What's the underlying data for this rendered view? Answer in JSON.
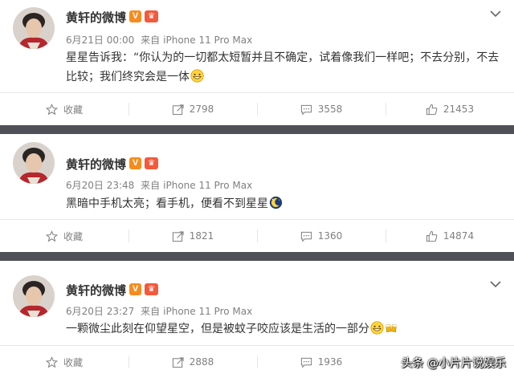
{
  "posts": [
    {
      "name": "黄轩的微博",
      "badge_v": "V",
      "time": "6月21日 00:00",
      "source_prefix": "来自",
      "source": "iPhone 11 Pro Max",
      "content": "星星告诉我：“你认为的一切都太短暂并且不确定，试着像我们一样吧；不去分别，不去比较；我们终究会是一体",
      "emoji": "grin-emoji",
      "actions": {
        "favorite": "收藏",
        "repost": "2798",
        "comment": "3558",
        "like": "21453"
      }
    },
    {
      "name": "黄轩的微博",
      "badge_v": "V",
      "time": "6月20日 23:48",
      "source_prefix": "来自",
      "source": "iPhone 11 Pro Max",
      "content": "黑暗中手机太亮；看手机，便看不到星星",
      "emoji": "moon-emoji",
      "actions": {
        "favorite": "收藏",
        "repost": "1821",
        "comment": "1360",
        "like": "14874"
      }
    },
    {
      "name": "黄轩的微博",
      "badge_v": "V",
      "time": "6月20日 23:27",
      "source_prefix": "来自",
      "source": "iPhone 11 Pro Max",
      "content": "一颗微尘此刻在仰望星空，但是被蚊子咬应该是生活的一部分",
      "emoji": "grin-emoji",
      "actions": {
        "favorite": "收藏",
        "repost": "2888",
        "comment": "1936",
        "like": ""
      }
    }
  ],
  "watermark": "头条 @小片片说娱乐",
  "colors": {
    "separator": "#4f5058",
    "badge_v": "#f78c1d",
    "badge_member": "#f25a3c",
    "meta_gray": "#808080"
  }
}
